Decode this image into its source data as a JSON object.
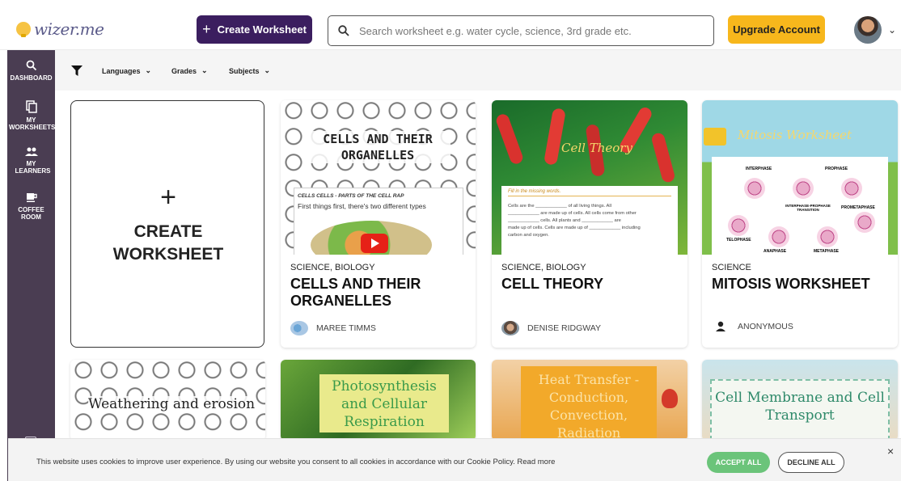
{
  "header": {
    "logo_text": "wizer.me",
    "create_label": "Create Worksheet",
    "search_placeholder": "Search worksheet e.g. water cycle, science, 3rd grade etc.",
    "upgrade_label": "Upgrade Account"
  },
  "sidebar": {
    "items": [
      {
        "label": "DASHBOARD",
        "icon": "search-icon"
      },
      {
        "label": "MY WORKSHEETS",
        "icon": "copy-icon"
      },
      {
        "label": "MY LEARNERS",
        "icon": "people-icon"
      },
      {
        "label": "COFFEE ROOM",
        "icon": "coffee-icon"
      }
    ]
  },
  "filters": {
    "languages": "Languages",
    "grades": "Grades",
    "subjects": "Subjects"
  },
  "create_card": {
    "plus": "+",
    "label_line1": "CREATE",
    "label_line2": "WORKSHEET"
  },
  "cards": [
    {
      "subject": "SCIENCE, BIOLOGY",
      "title": "CELLS AND THEIR ORGANELLES",
      "author": "MAREE TIMMS",
      "thumb_title": "CELLS AND THEIR ORGANELLES",
      "thumb_sub": "CELLS CELLS - PARTS OF THE CELL RAP",
      "thumb_text": "First things first, there's two different types"
    },
    {
      "subject": "SCIENCE, BIOLOGY",
      "title": "CELL THEORY",
      "author": "DENISE RIDGWAY",
      "thumb_title": "Cell Theory",
      "thumb_sub": "Fill in the missing words.",
      "thumb_lines": [
        "Cells are the ____________ of all living things. All",
        "____________ are made up of cells. All cells come from other",
        "____________ cells. All plants and ____________ are",
        "made up of cells. Cells are made up of ____________ including",
        "carbon and oxygen."
      ]
    },
    {
      "subject": "SCIENCE",
      "title": "MITOSIS WORKSHEET",
      "author": "ANONYMOUS",
      "thumb_title": "Mitosis Worksheet",
      "labels": [
        "INTERPHASE",
        "PROPHASE",
        "INTERPHASE-PROPHASE TRANSITION",
        "PROMETAPHASE",
        "TELOPHASE",
        "ANAPHASE",
        "METAPHASE"
      ]
    }
  ],
  "row2": [
    {
      "thumb_title": "Weathering and erosion"
    },
    {
      "thumb_title": "Photosynthesis and Cellular Respiration"
    },
    {
      "thumb_title": "Heat Transfer - Conduction, Convection, Radiation"
    },
    {
      "thumb_title": "Cell Membrane and Cell Transport"
    }
  ],
  "cookie": {
    "text": "This website uses cookies to improve user experience. By using our website you consent to all cookies in accordance with our Cookie Policy. Read more",
    "accept": "ACCEPT ALL",
    "decline": "DECLINE ALL",
    "close": "×"
  },
  "colors": {
    "brand_purple": "#3b1e5f",
    "upgrade_yellow": "#f7b71c",
    "sidebar": "#4a3d52",
    "accept_green": "#6bc47a"
  }
}
